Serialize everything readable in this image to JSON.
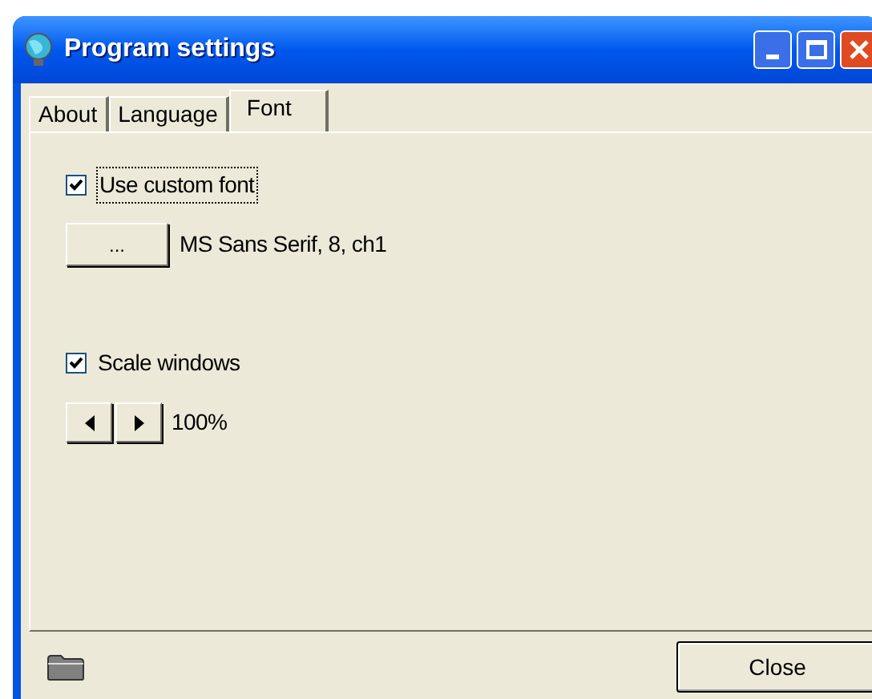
{
  "window": {
    "title": "Program settings"
  },
  "tabs": [
    {
      "label": "About",
      "selected": false
    },
    {
      "label": "Language",
      "selected": false
    },
    {
      "label": "Font",
      "selected": true
    }
  ],
  "custom_font": {
    "label": "Use custom font",
    "checked": true,
    "focused": true
  },
  "font_button": {
    "label": "..."
  },
  "font_name": "MS Sans Serif, 8, ch1",
  "scale_windows": {
    "label": "Scale windows",
    "checked": true
  },
  "scale_value": "100%",
  "close_button": {
    "label": "Close"
  }
}
